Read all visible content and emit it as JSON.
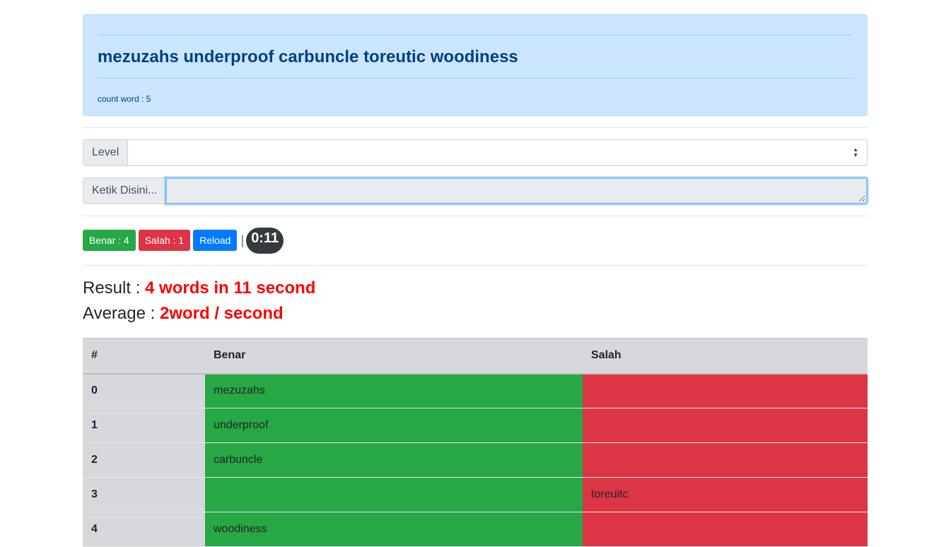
{
  "sentence": "mezuzahs underproof carbuncle toreutic woodiness",
  "count_label": "count word : ",
  "count_value": "5",
  "level": {
    "label": "Level",
    "selected": ""
  },
  "typing": {
    "label": "Ketik Disini...",
    "value": ""
  },
  "buttons": {
    "benar": "Benar : 4",
    "salah": "Salah : 1",
    "reload": "Reload",
    "separator": "|",
    "timer": "0:11"
  },
  "colors": {
    "success": "#28a745",
    "danger": "#dc3545",
    "primary": "#007bff",
    "dark": "#343a40",
    "highlight": "#ff0000"
  },
  "result": {
    "label": "Result : ",
    "value": "4 words in 11 second"
  },
  "average": {
    "label": "Average : ",
    "value": "2word / second"
  },
  "table": {
    "headers": [
      "#",
      "Benar",
      "Salah"
    ],
    "rows": [
      {
        "index": "0",
        "benar": "mezuzahs",
        "salah": ""
      },
      {
        "index": "1",
        "benar": "underproof",
        "salah": ""
      },
      {
        "index": "2",
        "benar": "carbuncle",
        "salah": ""
      },
      {
        "index": "3",
        "benar": "",
        "salah": "toreuitc"
      },
      {
        "index": "4",
        "benar": "woodiness",
        "salah": ""
      }
    ]
  }
}
